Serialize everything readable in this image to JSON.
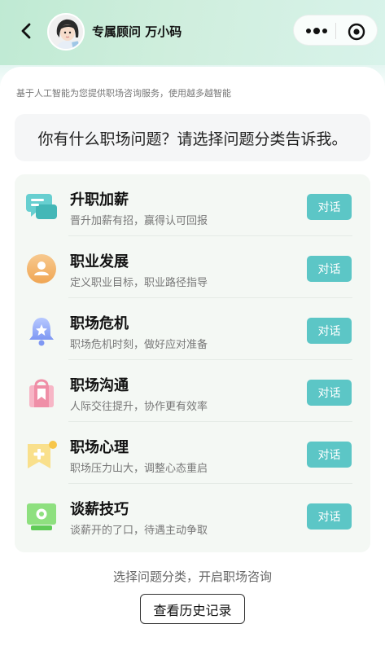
{
  "header": {
    "advisor_name": "专属顾问 万小码",
    "back_icon": "chevron-left-icon",
    "more_icon": "more-dots-icon",
    "close_icon": "target-circle-icon"
  },
  "subtitle": "基于人工智能为您提供职场咨询服务，使用越多越智能",
  "question": "你有什么职场问题？请选择问题分类告诉我。",
  "categories": [
    {
      "title": "升职加薪",
      "desc": "晋升加薪有招，赢得认可回报",
      "action": "对话",
      "icon": "chat-bubbles-icon"
    },
    {
      "title": "职业发展",
      "desc": "定义职业目标，职业路径指导",
      "action": "对话",
      "icon": "person-circle-icon"
    },
    {
      "title": "职场危机",
      "desc": "职场危机时刻，做好应对准备",
      "action": "对话",
      "icon": "bell-star-icon"
    },
    {
      "title": "职场沟通",
      "desc": "人际交往提升，协作更有效率",
      "action": "对话",
      "icon": "bag-bookmark-icon"
    },
    {
      "title": "职场心理",
      "desc": "职场压力山大，调整心态重启",
      "action": "对话",
      "icon": "heart-plus-icon"
    },
    {
      "title": "谈薪技巧",
      "desc": "谈薪开的了口，待遇主动争取",
      "action": "对话",
      "icon": "monitor-icon"
    }
  ],
  "footer": {
    "hint": "选择问题分类，开启职场咨询",
    "history_button": "查看历史记录"
  },
  "colors": {
    "accent": "#5cc6c6",
    "header_green": "#bfead3"
  }
}
